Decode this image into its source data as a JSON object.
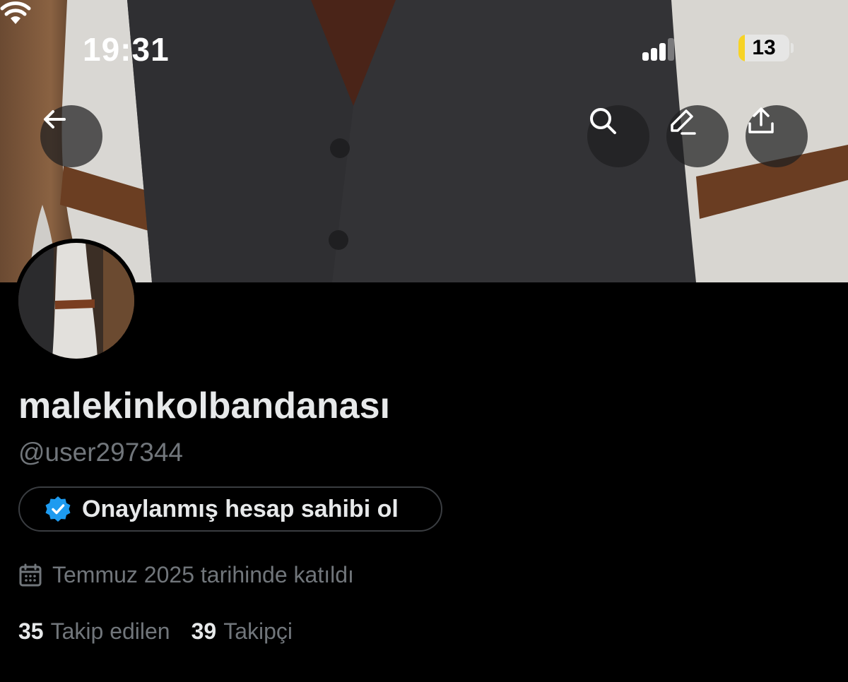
{
  "status_bar": {
    "time": "19:31",
    "battery_level": "13",
    "battery_fraction": 0.13,
    "signal_bars_active": 3,
    "signal_bars_total": 4
  },
  "nav": {
    "back_icon": "arrow-left-icon",
    "search_icon": "search-icon",
    "edit_icon": "pencil-icon",
    "share_icon": "share-upload-icon"
  },
  "profile": {
    "display_name": "malekinkolbandanası",
    "handle": "@user297344",
    "verify_label": "Onaylanmış hesap sahibi ol",
    "verify_badge_color": "#1d9bf0",
    "joined": "Temmuz 2025 tarihinde katıldı",
    "following_count": "35",
    "following_label": "Takip edilen",
    "followers_count": "39",
    "followers_label": "Takipçi"
  }
}
